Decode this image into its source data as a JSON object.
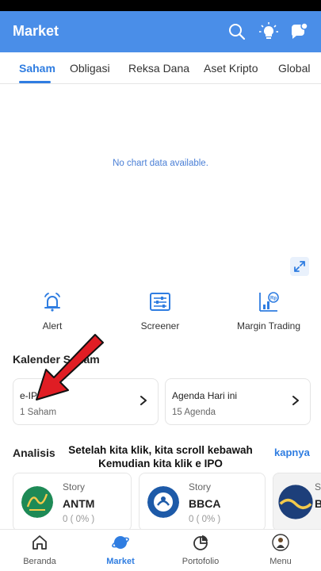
{
  "appbar": {
    "title": "Market",
    "icons": [
      "search-icon",
      "lightbulb-icon",
      "chat-icon"
    ]
  },
  "tabs": [
    {
      "label": "Saham",
      "active": true
    },
    {
      "label": "Obligasi",
      "active": false
    },
    {
      "label": "Reksa Dana",
      "active": false
    },
    {
      "label": "Aset Kripto",
      "active": false
    },
    {
      "label": "Global",
      "active": false
    }
  ],
  "chart": {
    "empty_text": "No chart data available."
  },
  "features": [
    {
      "label": "Alert",
      "icon": "alarm-icon"
    },
    {
      "label": "Screener",
      "icon": "screener-icon"
    },
    {
      "label": "Margin Trading",
      "icon": "margin-trading-icon"
    }
  ],
  "calendar": {
    "title": "Kalender Saham",
    "cards": [
      {
        "title": "e-IPO",
        "subtitle": "1 Saham"
      },
      {
        "title": "Agenda Hari ini",
        "subtitle": "15 Agenda"
      }
    ]
  },
  "analysis": {
    "title": "Analisis",
    "see_all": "kapnya"
  },
  "caption": {
    "line1": "Setelah kita klik, kita scroll kebawah",
    "line2": "Kemudian kita klik e IPO"
  },
  "stocks": [
    {
      "type": "Story",
      "code": "ANTM",
      "change": "0 ( 0% )",
      "logo_color": "#1e8a56"
    },
    {
      "type": "Story",
      "code": "BBCA",
      "change": "0 ( 0% )",
      "logo_color": "#1d5aa8"
    },
    {
      "type": "Story",
      "code": "B",
      "change": "",
      "logo_color": "#1d3f7a"
    }
  ],
  "bottom_nav": [
    {
      "label": "Beranda",
      "icon": "home-icon",
      "active": false
    },
    {
      "label": "Market",
      "icon": "market-icon",
      "active": true
    },
    {
      "label": "Portofolio",
      "icon": "portfolio-icon",
      "active": false
    },
    {
      "label": "Menu",
      "icon": "menu-avatar-icon",
      "active": false
    }
  ],
  "colors": {
    "appbar": "#4a8ee8",
    "accent": "#2f7de1",
    "arrow": "#e01d24"
  }
}
